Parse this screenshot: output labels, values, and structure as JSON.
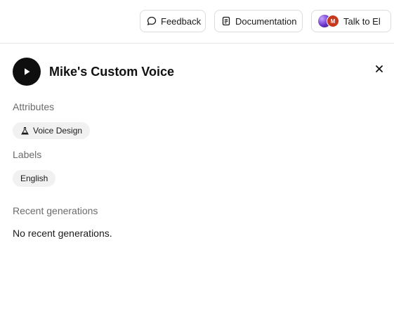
{
  "topbar": {
    "feedback_label": "Feedback",
    "docs_label": "Documentation",
    "talk_label": "Talk to El",
    "avatar_initial": "M"
  },
  "voice": {
    "name": "Mike's Custom Voice"
  },
  "attributes": {
    "heading": "Attributes",
    "items": [
      {
        "label": "Voice Design",
        "icon": "flask-icon"
      }
    ]
  },
  "labels": {
    "heading": "Labels",
    "items": [
      {
        "label": "English"
      }
    ]
  },
  "recent_generations": {
    "heading": "Recent generations",
    "empty_text": "No recent generations."
  },
  "colors": {
    "play_button": "#0e0e0e",
    "chip_bg": "#f1f1f1",
    "muted_text": "#6b6b6b",
    "avatar_red": "#c7381f"
  }
}
